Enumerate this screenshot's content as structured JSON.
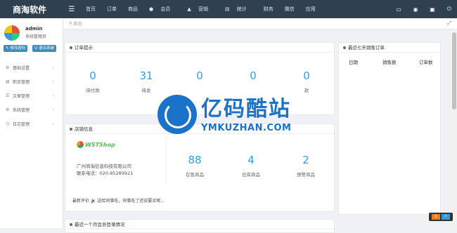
{
  "brand": "商淘软件",
  "nav": [
    "首页",
    "订单",
    "商品",
    "会员",
    "营销",
    "统计",
    "财务",
    "微信",
    "应用"
  ],
  "user": {
    "name": "admin",
    "role": "系统管理员",
    "btn_password": "修改密码",
    "btn_logout": "退出系统"
  },
  "sidebar": [
    {
      "label": "基础设置",
      "icon": "gear-icon"
    },
    {
      "label": "职员管理",
      "icon": "users-icon"
    },
    {
      "label": "文章管理",
      "icon": "document-icon"
    },
    {
      "label": "系统管理",
      "icon": "settings-icon"
    },
    {
      "label": "日志管理",
      "icon": "log-icon"
    }
  ],
  "breadcrumb": "首页",
  "orders": {
    "title": "订单提示",
    "stats": [
      {
        "value": "0",
        "label": "待付款"
      },
      {
        "value": "31",
        "label": "待发"
      },
      {
        "value": "0",
        "label": ""
      },
      {
        "value": "0",
        "label": ""
      },
      {
        "value": "0",
        "label": "款"
      }
    ]
  },
  "store": {
    "title": "店铺信息",
    "logo": "WSTShop",
    "company": "广州商淘信息科技有限公司",
    "phone": "联系电话：020-85289921",
    "stats": [
      {
        "value": "88",
        "label": "在售商品"
      },
      {
        "value": "4",
        "label": "仓库商品"
      },
      {
        "value": "2",
        "label": "预警商品"
      }
    ],
    "review_label": "最新评价",
    "review_text": "送给同事吃，同事吃了还说要买呢..."
  },
  "sales": {
    "title": "最近七天销售订单",
    "columns": [
      "日期",
      "销售额",
      "订单数"
    ]
  },
  "members": {
    "title": "最近一个月会员登录情况"
  },
  "watermark": {
    "cn": "亿码酷站",
    "en": "YMKUZHAN.COM"
  },
  "corner": {
    "a": "S",
    "b": "7"
  }
}
